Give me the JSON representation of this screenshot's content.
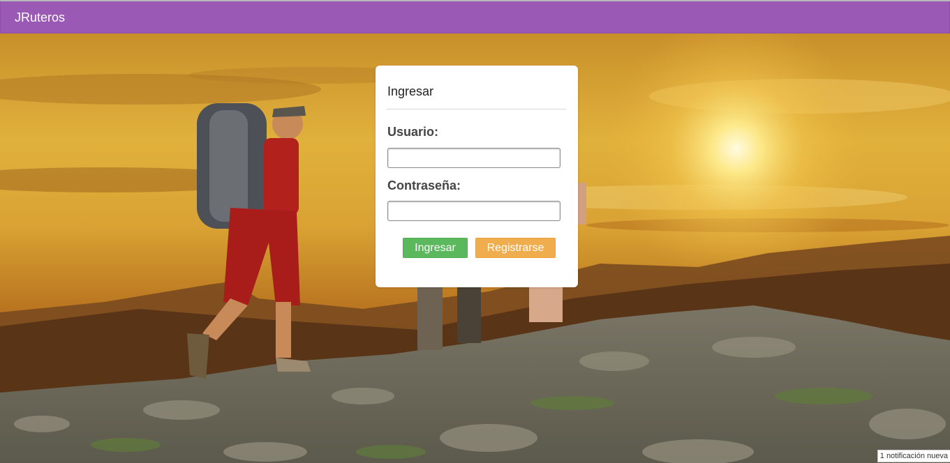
{
  "app": {
    "brand": "JRuteros"
  },
  "colors": {
    "navbar": "#9b59b6",
    "login_button": "#5cb85c",
    "register_button": "#f0ad4e"
  },
  "login_card": {
    "title": "Ingresar",
    "username_label": "Usuario:",
    "username_value": "",
    "password_label": "Contraseña:",
    "password_value": "",
    "login_button": "Ingresar",
    "register_button": "Registrarse"
  },
  "status": {
    "notification": "1 notificación nueva"
  }
}
